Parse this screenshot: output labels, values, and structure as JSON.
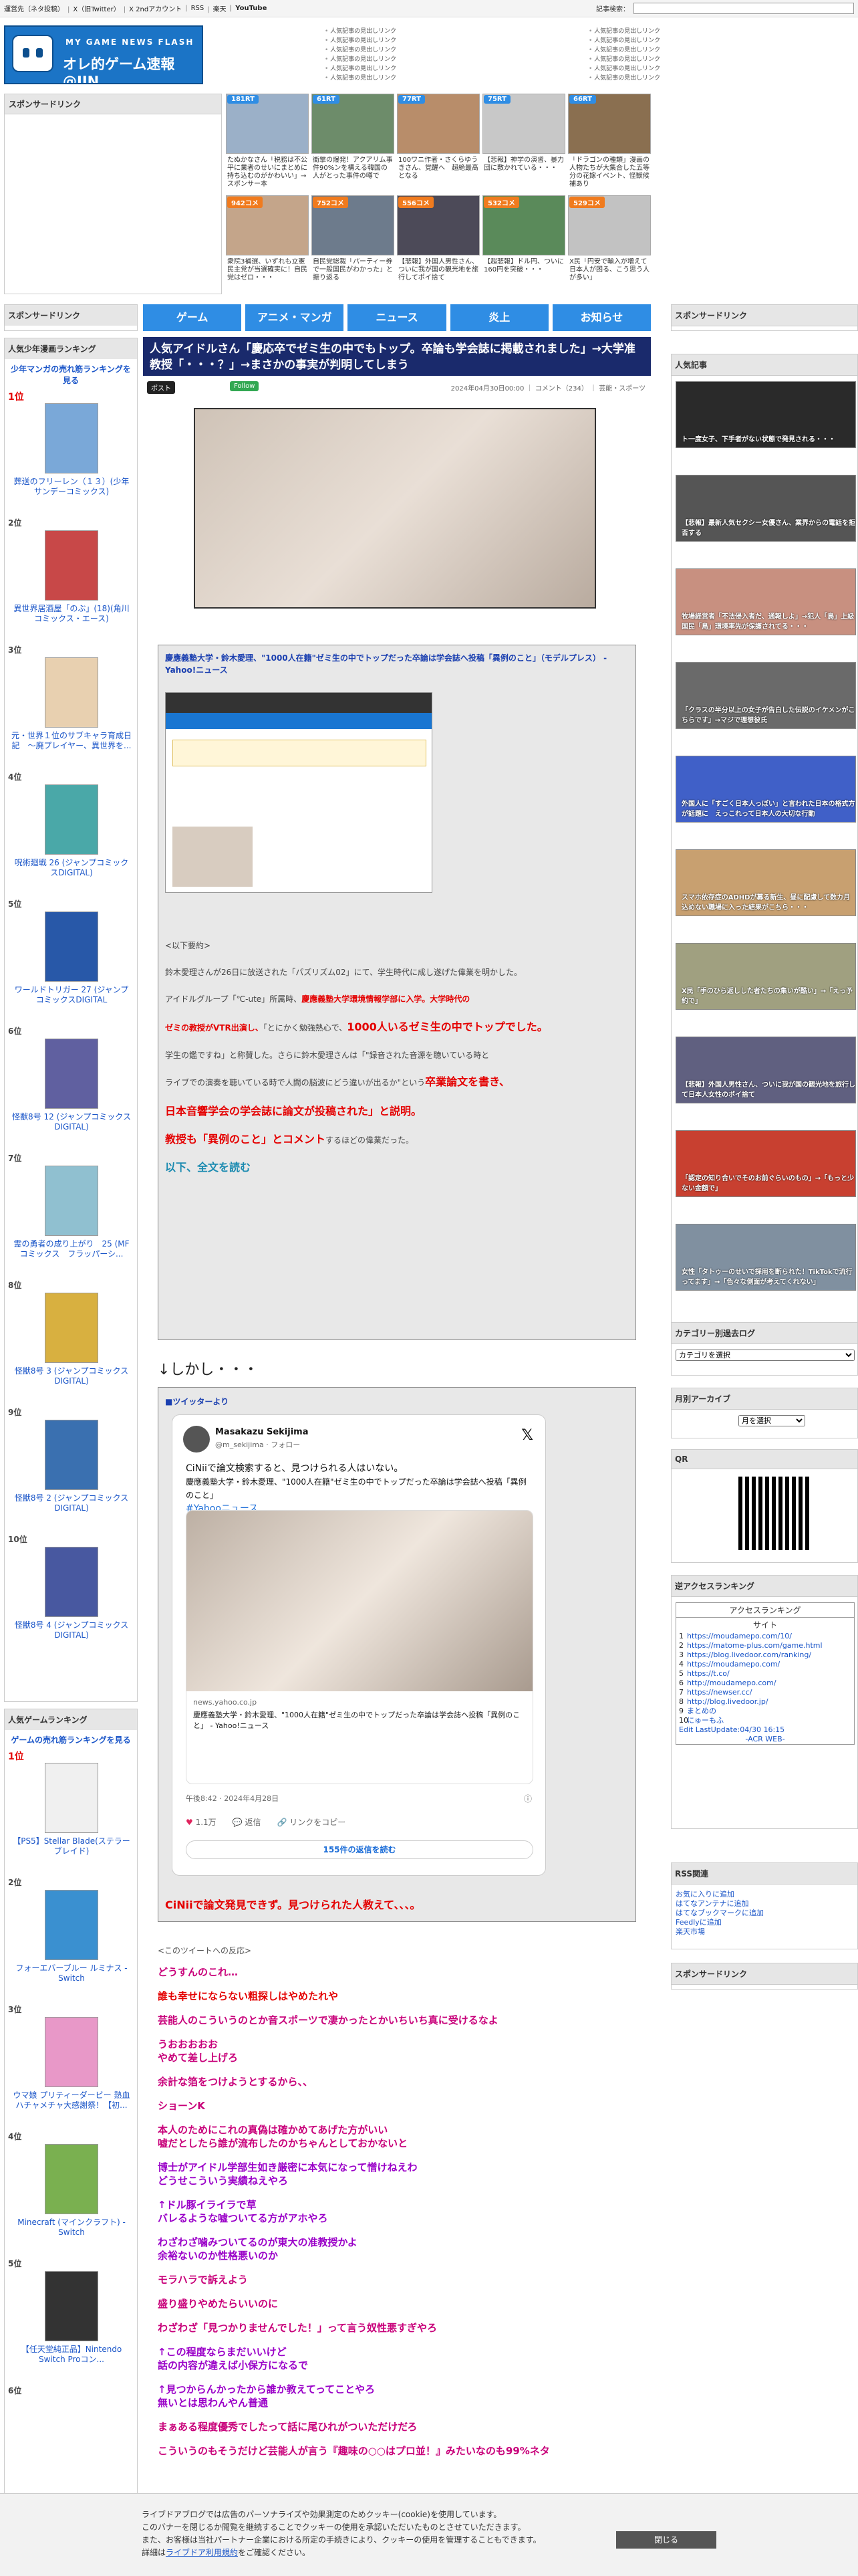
{
  "topbar": {
    "links": [
      "運営先（ネタ投稿）",
      "X（旧Twitter）",
      "X 2ndアカウント",
      "RSS",
      "楽天",
      "YouTube"
    ],
    "article_search_label": "記事検索："
  },
  "header": {
    "logo_sub": "MY GAME NEWS FLASH",
    "logo_main": "オレ的ゲーム速報@JIN",
    "links_left": [
      "人気記事の見出しリンク",
      "人気記事の見出しリンク",
      "人気記事の見出しリンク",
      "人気記事の見出しリンク",
      "人気記事の見出しリンク",
      "人気記事の見出しリンク"
    ],
    "links_right": [
      "人気記事の見出しリンク",
      "人気記事の見出しリンク",
      "人気記事の見出しリンク",
      "人気記事の見出しリンク",
      "人気記事の見出しリンク",
      "人気記事の見出しリンク"
    ]
  },
  "sponsored_link_label": "スポンサードリンク",
  "thumbs": [
    {
      "badge": "181RT",
      "badge_color": "#2f8de4",
      "caption": "たぬかなさん「税務は不公平に業者のせいにまとめに持ち込むのがかわいい」→スポンサー本"
    },
    {
      "badge": "61RT",
      "badge_color": "#2f8de4",
      "caption": "衝撃の爆発！アクアリム事件90%ンを構える韓国の人がとった事件の噂で"
    },
    {
      "badge": "77RT",
      "badge_color": "#2f8de4",
      "caption": "100ワニ作者・さくらゆうきさん、覚醒へ　超絶最高となる"
    },
    {
      "badge": "75RT",
      "badge_color": "#2f8de4",
      "caption": "【悲報】神学の演習、暴力団に敷かれている・・・"
    },
    {
      "badge": "66RT",
      "badge_color": "#2f8de4",
      "caption": "「ドラゴンの種類」漫画の人物たちが大集合した五等分の花嫁イベント、怪獣候補あり"
    },
    {
      "badge": "942コメ",
      "badge_color": "#f07b1e",
      "caption": "衆院3補選、いずれも立憲民主党が当選確実に！自民党はゼロ・・・"
    },
    {
      "badge": "752コメ",
      "badge_color": "#f07b1e",
      "caption": "自民党総裁「パーティー券で一般国民がわかった」と振り返る"
    },
    {
      "badge": "556コメ",
      "badge_color": "#f07b1e",
      "caption": "【悲報】外国人男性さん、ついに我が国の観光地を旅行してポイ捨て"
    },
    {
      "badge": "532コメ",
      "badge_color": "#f07b1e",
      "caption": "【超悲報】ドル円、ついに160円を突破・・・"
    },
    {
      "badge": "529コメ",
      "badge_color": "#f07b1e",
      "caption": "X民「円安で輸入が増えて日本人が困る、こう思う人が多い」"
    }
  ],
  "nav": [
    "ゲーム",
    "アニメ・マンガ",
    "ニュース",
    "炎上",
    "お知らせ"
  ],
  "left": {
    "manga_head": "人気少年漫画ランキング",
    "manga_link": "少年マンガの売れ筋ランキングを見る",
    "manga_items": [
      {
        "rank": "1位",
        "title": "葬送のフリーレン（１３）(少年サンデーコミックス)"
      },
      {
        "rank": "2位",
        "title": "異世界居酒屋「のぶ」(18)(角川コミックス・エース)"
      },
      {
        "rank": "3位",
        "title": "元・世界１位のサブキャラ育成日記　～廃プレイヤー、異世界を..."
      },
      {
        "rank": "4位",
        "title": "呪術廻戦 26 (ジャンプコミックスDIGITAL)"
      },
      {
        "rank": "5位",
        "title": "ワールドトリガー 27 (ジャンプコミックスDIGITAL"
      },
      {
        "rank": "6位",
        "title": "怪獣8号 12 (ジャンプコミックスDIGITAL)"
      },
      {
        "rank": "7位",
        "title": "霊の勇者の成り上がり　25 (MFコミックス　フラッパーシ..."
      },
      {
        "rank": "8位",
        "title": "怪獣8号 3 (ジャンプコミックスDIGITAL)"
      },
      {
        "rank": "9位",
        "title": "怪獣8号 2 (ジャンプコミックスDIGITAL)"
      },
      {
        "rank": "10位",
        "title": "怪獣8号 4 (ジャンプコミックスDIGITAL)"
      }
    ],
    "game_head": "人気ゲームランキング",
    "game_link": "ゲームの売れ筋ランキングを見る",
    "game_items": [
      {
        "rank": "1位",
        "title": "【PS5】Stellar Blade(ステラーブレイド)"
      },
      {
        "rank": "2位",
        "title": "フォーエバーブルー ルミナス -Switch"
      },
      {
        "rank": "3位",
        "title": "ウマ娘 プリティーダービー 熱血ハチャメチャ大感謝祭！【初..."
      },
      {
        "rank": "4位",
        "title": "Minecraft (マインクラフト) -Switch"
      },
      {
        "rank": "5位",
        "title": "【任天堂純正品】Nintendo Switch Proコン..."
      },
      {
        "rank": "6位",
        "title": ""
      }
    ]
  },
  "article": {
    "title": "人気アイドルさん「慶応卒でゼミ生の中でもトップ。卒論も学会誌に掲載されました」→大学准教授「・・・？」→まさかの事実が判明してしまう",
    "x_label": "ポスト",
    "follow_label": "Follow",
    "meta": "2024年04月30日00:00 ｜ コメント（234） ｜ 芸能・スポーツ",
    "yahoo_link": "慶應義塾大学・鈴木愛理、\"1000人在籍\"ゼミ生の中でトップだった卒論は学会誌へ投稿「異例のこと」（モデルプレス） - Yahoo!ニュース",
    "summary_label": "<以下要約>",
    "p1": "鈴木愛理さんが26日に放送された「パズリズム02」にて、学生時代に成し遂げた偉業を明かした。",
    "p2a": "アイドルグループ「℃-ute」所属時、",
    "p2b": "慶應義塾大学環境情報学部に入学。大学時代の",
    "p3a": "ゼミの教授がVTR出演し、",
    "p3b": "「とにかく勉強熱心で、",
    "p3c": "1000人いるゼミ生の中でトップでした。",
    "p4a": "学生の鑑ですね」と称賛した。さらに鈴木愛理さんは「\"録音された音源を聴いている時と",
    "p4b": "ライブでの演奏を聴いている時で人間の脳波にどう違いが出るか\"という",
    "p4c": "卒業論文を書き、",
    "p5": "日本音響学会の学会誌に論文が投稿された」と説明。",
    "p6a": "教授も「異例のこと」とコメント",
    "p6b": "するほどの偉業だった。",
    "read_more": "以下、全文を読む",
    "shikashi": "↓しかし・・・",
    "twitter_from": "■ツイッターより",
    "tweet": {
      "name": "Masakazu Sekijima",
      "handle": "@m_sekijima · フォロー",
      "text": "CiNiiで論文検索すると、見つけられる人はいない。",
      "text2": "慶應義塾大学・鈴木愛理、\"1000人在籍\"ゼミ生の中でトップだった卒論は学会誌へ投稿「異例のこと」",
      "tag": "#Yahooニュース",
      "card_domain": "news.yahoo.co.jp",
      "card_title": "慶應義塾大学・鈴木愛理、\"1000人在籍\"ゼミ生の中でトップだった卒論は学会誌へ投稿「異例のこと」 - Yahoo!ニュース",
      "time": "午後8:42 · 2024年4月28日",
      "likes": "1.1万",
      "replies": "返信",
      "link": "リンクをコピー",
      "more": "155件の返信を読む"
    },
    "q2foot": "CiNiiで論文発見できず。見つけられた人教えて、、、。",
    "reactions_head": "<このツイートへの反応>",
    "reactions": [
      {
        "text": "どうすんのこれ…",
        "color": "#c8007a"
      },
      {
        "text": "誰も幸せにならない粗探しはやめたれや",
        "color": "#e40000"
      },
      {
        "text": "芸能人のこういうのとか音スポーツで凄かったとかいちいち真に受けるなよ",
        "color": "#c8007a"
      },
      {
        "text": "うおおおおお\nやめて差し上げろ",
        "color": "#c8007a"
      },
      {
        "text": "余計な箔をつけようとするから、、",
        "color": "#c8007a"
      },
      {
        "text": "ショーンK",
        "color": "#c8007a"
      },
      {
        "text": "本人のためにこれの真偽は確かめてあげた方がいい\n嘘だとしたら誰が流布したのかちゃんとしておかないと",
        "color": "#c8007a"
      },
      {
        "text": "博士がアイドル学部生如き厳密に本気になって憎けねえわ\nどうせこういう実績ねえやろ",
        "color": "#9a00c8"
      },
      {
        "text": "↑ドル豚イライラで草\nバレるような嘘ついてる方がアホやろ",
        "color": "#9a00c8"
      },
      {
        "text": "わざわざ噛みついてるのが東大の准教授かよ\n余裕ないのか性格悪いのか",
        "color": "#9a00c8"
      },
      {
        "text": "モラハラで訴えよう",
        "color": "#c8007a"
      },
      {
        "text": "盛り盛りやめたらいいのに",
        "color": "#c8007a"
      },
      {
        "text": "わざわざ「見つかりませんでした！」って言う奴性悪すぎやろ",
        "color": "#c8007a"
      },
      {
        "text": "↑この程度ならまだいいけど\n話の内容が違えば小保方になるで",
        "color": "#9a00c8"
      },
      {
        "text": "↑見つからんかったから誰か教えてってことやろ\n無いとは思わんやん普通",
        "color": "#9a00c8"
      },
      {
        "text": "まぁある程度優秀でしたって話に尾ひれがついただけだろ",
        "color": "#c8007a"
      },
      {
        "text": "こういうのもそうだけど芸能人が言う『趣味の○○はプロ並！』みたいなのも99%ネタ",
        "color": "#c8007a"
      }
    ]
  },
  "right": {
    "popular_head": "人気記事",
    "popular_items": [
      "ト一度女子、下手者がない状態で発見される・・・",
      "【悲報】最新人気セクシー女優さん、業界からの電話を拒否する",
      "牧場経営者「不法侵入者だ、通報しよ」→犯人「鳥」上級国民「鳥」環境率先が保護されてる・・・",
      "「クラスの半分以上の女子が告白した伝説のイケメンがこちらです」→マジで理想彼氏",
      "外国人に「すごく日本人っぽい」と言われた日本の格式方が話題に　えっこれって日本人の大切な行動",
      "スマホ依存症のADHDが募る新生、昼に配慮して数カ月込めない職場に入った結果がこちら・・・",
      "X民「手のひら返しした者たちの集いが酷い」→「えっ予約で」",
      "【悲報】外国人男性さん、ついに我が国の観光地を旅行して日本人女性のポイ捨て",
      "「認定の知り合いでそのお前ぐらいのもの」→「もっと少ない金額で」",
      "女性「タトゥーのせいで採用を断られた！TikTokで流行ってます」→「色々な側面が考えてくれない」"
    ],
    "category_head": "カテゴリー別過去ログ",
    "category_select": "カテゴリを選択",
    "monthly_head": "月別アーカイブ",
    "monthly_select": "月を選択",
    "qr_head": "QR",
    "access_head": "逆アクセスランキング",
    "access_title": "アクセスランキング",
    "access_sub": "サイト",
    "access_rows": [
      {
        "n": "1",
        "url": "https://moudamepo.com/10/"
      },
      {
        "n": "2",
        "url": "https://matome-plus.com/game.html"
      },
      {
        "n": "3",
        "url": "https://blog.livedoor.com/ranking/"
      },
      {
        "n": "4",
        "url": "https://moudamepo.com/"
      },
      {
        "n": "5",
        "url": "https://t.co/"
      },
      {
        "n": "6",
        "url": "http://moudamepo.com/"
      },
      {
        "n": "7",
        "url": "https://newser.cc/"
      },
      {
        "n": "8",
        "url": "http://blog.livedoor.jp/"
      },
      {
        "n": "9",
        "url": "まとめの"
      },
      {
        "n": "10",
        "url": "にゅーもふ"
      }
    ],
    "access_footer": "Edit LastUpdate:04/30 16:15",
    "access_brand": "-ACR WEB-",
    "rss_head": "RSS関連",
    "rss_links": [
      "お気に入りに追加",
      "はてなアンテナに追加",
      "はてなブックマークに追加",
      "Feedlyに追加",
      "楽天市場"
    ],
    "sponsored_head": "スポンサードリンク"
  },
  "cookie": {
    "line1": "ライブドアブログでは広告のパーソナライズや効果測定のためクッキー(cookie)を使用しています。",
    "line2": "このバナーを閉じるか閲覧を継続することでクッキーの使用を承認いただいたものとさせていただきます。",
    "line3": "また、お客様は当社パートナー企業における所定の手続きにより、クッキーの使用を管理することもできます。",
    "line4a": "詳細は",
    "line4b": "ライブドア利用規約",
    "line4c": "をご確認ください。",
    "close": "閉じる"
  }
}
